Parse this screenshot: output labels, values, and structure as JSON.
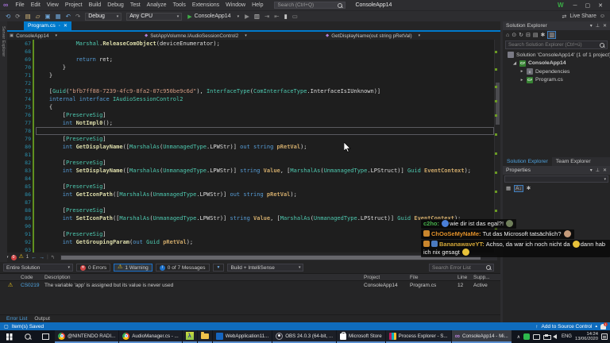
{
  "colors": {
    "accent": "#007ACC",
    "statusbar": "#0f6cbd",
    "taskbar": "#10141c"
  },
  "glyphs": {
    "caret": "▾",
    "close": "✕",
    "minimize": "─",
    "maximize": "▢",
    "play": "▶",
    "pin": "⊥",
    "collapsed": "▸",
    "expanded": "◢",
    "up_arrow": "↑",
    "small_caret": "▴",
    "dot": "◦",
    "warning": "⚠"
  },
  "titlebar": {
    "menus": [
      "File",
      "Edit",
      "View",
      "Project",
      "Build",
      "Debug",
      "Test",
      "Analyze",
      "Tools",
      "Extensions",
      "Window",
      "Help"
    ],
    "search_placeholder": "Search (Ctrl+Q)",
    "solution_name": "ConsoleApp14",
    "account_initial": "W",
    "window_buttons": [
      {
        "name": "minimize-button",
        "glyph": "─"
      },
      {
        "name": "maximize-button",
        "glyph": "▢"
      },
      {
        "name": "close-button",
        "glyph": "✕"
      }
    ]
  },
  "toolbar": {
    "left_icons": [
      {
        "name": "navigate-back-icon",
        "glyph": "⟲",
        "color": "#6fa8dc"
      },
      {
        "name": "navigate-forward-icon",
        "glyph": "⟳",
        "color": "#9a9a9a"
      },
      {
        "name": "new-file-icon",
        "glyph": "▤",
        "color": "#d7ba7d"
      },
      {
        "name": "open-folder-icon",
        "glyph": "▱",
        "color": "#d7ba7d"
      },
      {
        "name": "save-icon",
        "glyph": "▣",
        "color": "#6fa8dc"
      },
      {
        "name": "save-all-icon",
        "glyph": "▦",
        "color": "#6fa8dc"
      },
      {
        "name": "undo-icon",
        "glyph": "↶",
        "color": "#6fa8dc"
      },
      {
        "name": "redo-icon",
        "glyph": "↷",
        "color": "#8a8a8a"
      }
    ],
    "debug_target": "Debug",
    "platform": "Any CPU",
    "run_label": "ConsoleApp14",
    "right_icons": [
      {
        "name": "attach-process-icon",
        "glyph": "▶",
        "color": "#8a8a8a"
      },
      {
        "name": "quick-actions-icon",
        "glyph": "▥",
        "color": "#c8c8c8"
      },
      {
        "name": "step-over-icon",
        "glyph": "⇥",
        "color": "#8a8a8a"
      },
      {
        "name": "step-into-icon",
        "glyph": "⇤",
        "color": "#8a8a8a"
      },
      {
        "name": "bookmark-icon",
        "glyph": "▮",
        "color": "#c8c8c8"
      },
      {
        "name": "comment-icon",
        "glyph": "▭",
        "color": "#8a8a8a"
      }
    ],
    "live_share_label": "Live Share",
    "share_icon_glyph": "⇄",
    "feedback_icon_glyph": "☺"
  },
  "side_strip_label": "Server Explorer",
  "tab": {
    "label": "Program.cs"
  },
  "breadcrumb": {
    "project": "ConsoleApp14",
    "type": "SetAppVolumne.IAudioSessionControl2",
    "member": "GetDisplayName(out string pRetVal)"
  },
  "editor": {
    "colors": {
      "keyword": "#569CD6",
      "type": "#4EC9B0",
      "method": "#DCDCAA",
      "string": "#D69D85",
      "param": "#CDA869",
      "plain": "#DCDCDC",
      "linenum": "#2B91AF"
    },
    "current_line": 78,
    "lines": [
      {
        "n": 67,
        "t": [
          [
            "w",
            "            "
          ],
          [
            "t",
            "Marshal"
          ],
          [
            "w",
            "."
          ],
          [
            "m",
            "ReleaseComObject"
          ],
          [
            "w",
            "(deviceEnumerator);"
          ]
        ]
      },
      {
        "n": 68,
        "t": []
      },
      {
        "n": 69,
        "t": [
          [
            "w",
            "            "
          ],
          [
            "k",
            "return"
          ],
          [
            "w",
            " ret;"
          ]
        ]
      },
      {
        "n": 70,
        "t": [
          [
            "w",
            "        }"
          ]
        ]
      },
      {
        "n": 71,
        "t": [
          [
            "w",
            "    }"
          ]
        ]
      },
      {
        "n": 72,
        "t": []
      },
      {
        "n": 73,
        "t": [
          [
            "w",
            "    ["
          ],
          [
            "t",
            "Guid"
          ],
          [
            "w",
            "("
          ],
          [
            "s",
            "\"bfb7ff88-7239-4fc9-8fa2-07c950be9c6d\""
          ],
          [
            "w",
            "), "
          ],
          [
            "t",
            "InterfaceType"
          ],
          [
            "w",
            "("
          ],
          [
            "t",
            "ComInterfaceType"
          ],
          [
            "w",
            ".InterfaceIsIUnknown)]"
          ]
        ]
      },
      {
        "n": 74,
        "t": [
          [
            "w",
            "    "
          ],
          [
            "k",
            "internal"
          ],
          [
            "w",
            " "
          ],
          [
            "k",
            "interface"
          ],
          [
            "w",
            " "
          ],
          [
            "t",
            "IAudioSessionControl2"
          ]
        ]
      },
      {
        "n": 75,
        "t": [
          [
            "w",
            "    {"
          ]
        ]
      },
      {
        "n": 76,
        "t": [
          [
            "w",
            "        ["
          ],
          [
            "t",
            "PreserveSig"
          ],
          [
            "w",
            "]"
          ]
        ]
      },
      {
        "n": 77,
        "t": [
          [
            "w",
            "        "
          ],
          [
            "k",
            "int"
          ],
          [
            "w",
            " "
          ],
          [
            "m",
            "NotImpl0"
          ],
          [
            "w",
            "();"
          ]
        ]
      },
      {
        "n": 78,
        "t": []
      },
      {
        "n": 79,
        "t": [
          [
            "w",
            "        ["
          ],
          [
            "t",
            "PreserveSig"
          ],
          [
            "w",
            "]"
          ]
        ]
      },
      {
        "n": 80,
        "t": [
          [
            "w",
            "        "
          ],
          [
            "k",
            "int"
          ],
          [
            "w",
            " "
          ],
          [
            "m",
            "GetDisplayName"
          ],
          [
            "w",
            "(["
          ],
          [
            "t",
            "MarshalAs"
          ],
          [
            "w",
            "("
          ],
          [
            "t",
            "UnmanagedType"
          ],
          [
            "w",
            ".LPWStr)] "
          ],
          [
            "k",
            "out"
          ],
          [
            "w",
            " "
          ],
          [
            "k",
            "string"
          ],
          [
            "w",
            " "
          ],
          [
            "p",
            "pRetVal"
          ],
          [
            "w",
            ");"
          ]
        ]
      },
      {
        "n": 81,
        "t": []
      },
      {
        "n": 82,
        "t": [
          [
            "w",
            "        ["
          ],
          [
            "t",
            "PreserveSig"
          ],
          [
            "w",
            "]"
          ]
        ]
      },
      {
        "n": 83,
        "t": [
          [
            "w",
            "        "
          ],
          [
            "k",
            "int"
          ],
          [
            "w",
            " "
          ],
          [
            "m",
            "SetDisplayName"
          ],
          [
            "w",
            "(["
          ],
          [
            "t",
            "MarshalAs"
          ],
          [
            "w",
            "("
          ],
          [
            "t",
            "UnmanagedType"
          ],
          [
            "w",
            ".LPWStr)] "
          ],
          [
            "k",
            "string"
          ],
          [
            "w",
            " "
          ],
          [
            "p",
            "Value"
          ],
          [
            "w",
            ", ["
          ],
          [
            "t",
            "MarshalAs"
          ],
          [
            "w",
            "("
          ],
          [
            "t",
            "UnmanagedType"
          ],
          [
            "w",
            ".LPStruct)] "
          ],
          [
            "t",
            "Guid"
          ],
          [
            "w",
            " "
          ],
          [
            "p",
            "EventContext"
          ],
          [
            "w",
            ");"
          ]
        ]
      },
      {
        "n": 84,
        "t": []
      },
      {
        "n": 85,
        "t": [
          [
            "w",
            "        ["
          ],
          [
            "t",
            "PreserveSig"
          ],
          [
            "w",
            "]"
          ]
        ]
      },
      {
        "n": 86,
        "t": [
          [
            "w",
            "        "
          ],
          [
            "k",
            "int"
          ],
          [
            "w",
            " "
          ],
          [
            "m",
            "GetIconPath"
          ],
          [
            "w",
            "(["
          ],
          [
            "t",
            "MarshalAs"
          ],
          [
            "w",
            "("
          ],
          [
            "t",
            "UnmanagedType"
          ],
          [
            "w",
            ".LPWStr)] "
          ],
          [
            "k",
            "out"
          ],
          [
            "w",
            " "
          ],
          [
            "k",
            "string"
          ],
          [
            "w",
            " "
          ],
          [
            "p",
            "pRetVal"
          ],
          [
            "w",
            ");"
          ]
        ]
      },
      {
        "n": 87,
        "t": []
      },
      {
        "n": 88,
        "t": [
          [
            "w",
            "        ["
          ],
          [
            "t",
            "PreserveSig"
          ],
          [
            "w",
            "]"
          ]
        ]
      },
      {
        "n": 89,
        "t": [
          [
            "w",
            "        "
          ],
          [
            "k",
            "int"
          ],
          [
            "w",
            " "
          ],
          [
            "m",
            "SetIconPath"
          ],
          [
            "w",
            "(["
          ],
          [
            "t",
            "MarshalAs"
          ],
          [
            "w",
            "("
          ],
          [
            "t",
            "UnmanagedType"
          ],
          [
            "w",
            ".LPWStr)] "
          ],
          [
            "k",
            "string"
          ],
          [
            "w",
            " "
          ],
          [
            "p",
            "Value"
          ],
          [
            "w",
            ", ["
          ],
          [
            "t",
            "MarshalAs"
          ],
          [
            "w",
            "("
          ],
          [
            "t",
            "UnmanagedType"
          ],
          [
            "w",
            ".LPStruct)] "
          ],
          [
            "t",
            "Guid"
          ],
          [
            "w",
            " "
          ],
          [
            "p",
            "EventContext"
          ],
          [
            "w",
            ");"
          ]
        ]
      },
      {
        "n": 90,
        "t": []
      },
      {
        "n": 91,
        "t": [
          [
            "w",
            "        ["
          ],
          [
            "t",
            "PreserveSig"
          ],
          [
            "w",
            "]"
          ]
        ]
      },
      {
        "n": 92,
        "t": [
          [
            "w",
            "        "
          ],
          [
            "k",
            "int"
          ],
          [
            "w",
            " "
          ],
          [
            "m",
            "GetGroupingParam"
          ],
          [
            "w",
            "("
          ],
          [
            "k",
            "out"
          ],
          [
            "w",
            " "
          ],
          [
            "t",
            "Guid"
          ],
          [
            "w",
            " "
          ],
          [
            "p",
            "pRetVal"
          ],
          [
            "w",
            ");"
          ]
        ]
      },
      {
        "n": 93,
        "t": []
      }
    ]
  },
  "health": {
    "errors": "0",
    "warnings": "1"
  },
  "error_list": {
    "scope": "Entire Solution",
    "errors_label": "0 Errors",
    "warnings_label": "1 Warning",
    "messages_label": "0 of 7 Messages",
    "build_filter": "Build + IntelliSense",
    "search_placeholder": "Search Error List",
    "columns": {
      "code": "Code",
      "description": "Description",
      "project": "Project",
      "file": "File",
      "line": "Line",
      "suppression": "Supp..."
    },
    "rows": [
      {
        "severity": "warning",
        "code": "CS0219",
        "description": "The variable 'app' is assigned but its value is never used",
        "project": "ConsoleApp14",
        "file": "Program.cs",
        "line": "12",
        "suppression": "Active"
      }
    ]
  },
  "panel_tabs": {
    "active": "Error List",
    "inactive": "Output"
  },
  "statusbar": {
    "left": "Item(s) Saved",
    "source_control": "Add to Source Control",
    "notification_count": "1"
  },
  "solution_explorer": {
    "title": "Solution Explorer",
    "toolbar_icons": [
      {
        "name": "home-icon",
        "glyph": "⌂"
      },
      {
        "name": "pending-changes-filter-icon",
        "glyph": "⊙"
      },
      {
        "name": "sync-with-active-document-icon",
        "glyph": "↻"
      },
      {
        "name": "collapse-all-icon",
        "glyph": "⊟"
      },
      {
        "name": "show-all-files-icon",
        "glyph": "▤"
      },
      {
        "name": "properties-icon",
        "glyph": "✱"
      },
      {
        "name": "preview-selected-items-icon",
        "glyph": "▥",
        "boxed": true
      }
    ],
    "search_placeholder": "Search Solution Explorer (Ctrl+ü)",
    "items": [
      {
        "label": "Solution 'ConsoleApp14' (1 of 1 project)",
        "icon": "solution",
        "icon_text": "",
        "indent": 0,
        "arrow": "none",
        "bold": false
      },
      {
        "label": "ConsoleApp14",
        "icon": "csproj",
        "icon_text": "C#",
        "indent": 1,
        "arrow": "expanded",
        "bold": true
      },
      {
        "label": "Dependencies",
        "icon": "deps",
        "icon_text": "≡",
        "indent": 2,
        "arrow": "collapsed",
        "bold": false
      },
      {
        "label": "Program.cs",
        "icon": "csfile",
        "icon_text": "C#",
        "indent": 2,
        "arrow": "collapsed",
        "bold": false
      }
    ]
  },
  "right_tabs": {
    "active": "Solution Explorer",
    "inactive": "Team Explorer"
  },
  "properties": {
    "title": "Properties",
    "toolbar_icons": [
      {
        "name": "categorized-icon",
        "glyph": "▦"
      },
      {
        "name": "alphabetical-sort-icon",
        "glyph": "A↓",
        "boxed": true
      },
      {
        "name": "property-pages-icon",
        "glyph": "✱"
      }
    ]
  },
  "chat": {
    "messages": [
      {
        "badges": [],
        "name": "c2ho:",
        "name_color": "#46b14b",
        "segments": [
          {
            "e": "crying-laughing-emote",
            "c": "#4a7fd8"
          },
          {
            "t": "wie dir ist das egal?!"
          },
          {
            "e": "pepe-emote",
            "c": "#6f7f5a"
          }
        ]
      },
      {
        "badges": [
          {
            "name": "sub-gift-badge",
            "c": "#c9862d"
          }
        ],
        "name": "ChOoSeMyNaMe:",
        "name_color": "#e0902a",
        "segments": [
          {
            "t": "Tut das Microsoft tatsächlich?"
          },
          {
            "e": "monka-emote",
            "c": "#c49a7a"
          }
        ]
      },
      {
        "badges": [
          {
            "name": "sub-gift-badge",
            "c": "#c9862d"
          },
          {
            "name": "subscriber-badge",
            "c": "#4a7abf"
          }
        ],
        "name": "BananawaveYT:",
        "name_color": "#d2a638",
        "segments": [
          {
            "t": "Achso, da war ich noch nicht da"
          },
          {
            "e": "sweat-smile-emote",
            "c": "#e8c23a"
          },
          {
            "t": "dann hab ich nix gesagt"
          },
          {
            "e": "sweat-smile-emote",
            "c": "#e8c23a"
          }
        ]
      }
    ]
  },
  "taskbar": {
    "items": [
      {
        "icon": "chrome",
        "icon_name": "chrome-icon",
        "label": "@NINTENDO RADI...",
        "active": false
      },
      {
        "icon": "chrome",
        "icon_name": "chrome-icon",
        "label": "AudioManager.cs - ...",
        "active": false
      },
      {
        "icon": "lambda",
        "icon_name": "lambda-app-icon",
        "label": "",
        "active": false,
        "glyph": "λ"
      },
      {
        "icon": "folder",
        "icon_name": "file-explorer-icon",
        "label": "",
        "active": false
      },
      {
        "icon": "webapp",
        "icon_name": "webapplication-icon",
        "label": "WebApplication11...",
        "active": false
      },
      {
        "icon": "obs",
        "icon_name": "obs-icon",
        "label": "OBS 24.0.3 (64-bit, ...",
        "active": false
      },
      {
        "icon": "store",
        "icon_name": "microsoft-store-icon",
        "label": "Microsoft Store",
        "active": false
      },
      {
        "icon": "procexp",
        "icon_name": "process-explorer-icon",
        "label": "Process Explorer - S...",
        "active": false
      },
      {
        "icon": "vs",
        "icon_name": "visual-studio-icon",
        "label": "ConsoleApp14 - Mi...",
        "active": true,
        "glyph": "∞"
      }
    ],
    "tray": {
      "language": "ENG",
      "time": "14:24",
      "date": "13/06/2020"
    }
  }
}
